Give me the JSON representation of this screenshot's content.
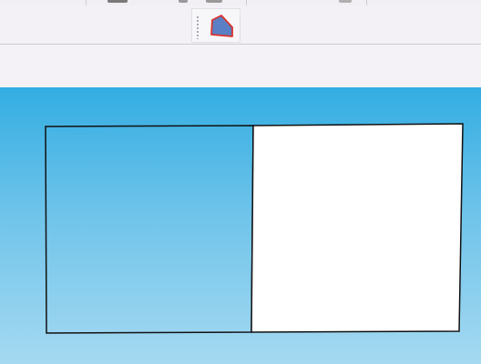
{
  "toolbar": {
    "shape_tool": {
      "icon": "polygon-shape-icon",
      "fill": "#5b7fc4",
      "stroke": "#d9342b"
    }
  },
  "canvas": {
    "background_top": "#32ade2",
    "background_bottom": "#a5d9f1",
    "left_panel_fill": "transparent",
    "right_panel_fill": "#ffffff",
    "outline_color": "#111111"
  }
}
